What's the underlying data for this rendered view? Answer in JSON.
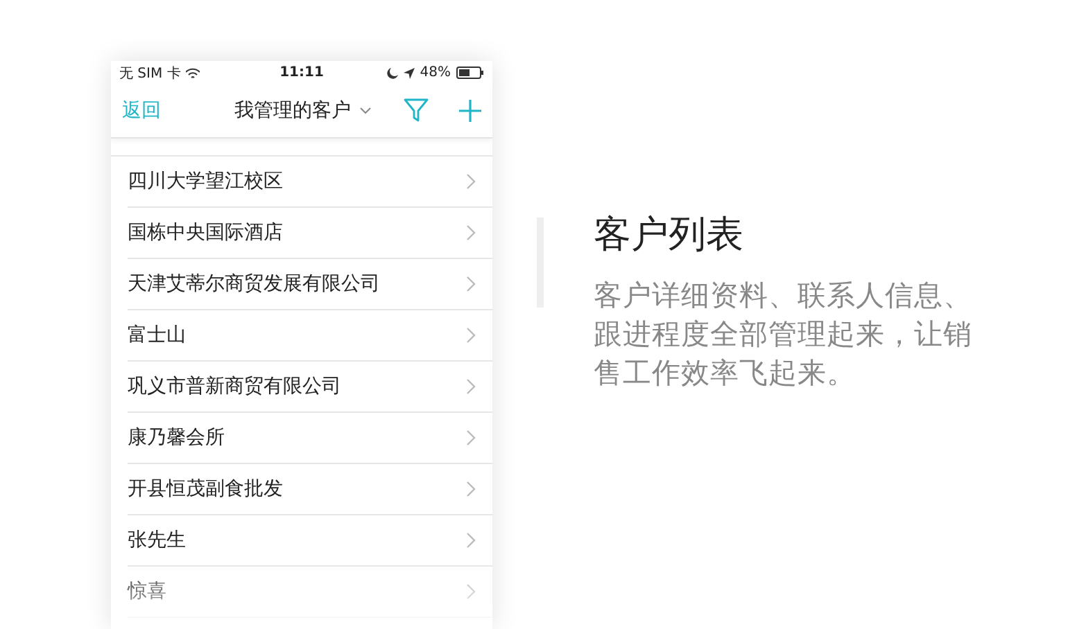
{
  "status_bar": {
    "carrier": "无 SIM 卡",
    "time": "11:11",
    "battery": "48%"
  },
  "nav": {
    "back": "返回",
    "title": "我管理的客户"
  },
  "customers": [
    {
      "name": "四川大学望江校区"
    },
    {
      "name": "国栋中央国际酒店"
    },
    {
      "name": "天津艾蒂尔商贸发展有限公司"
    },
    {
      "name": "富士山"
    },
    {
      "name": "巩义市普新商贸有限公司"
    },
    {
      "name": "康乃馨会所"
    },
    {
      "name": "开县恒茂副食批发"
    },
    {
      "name": "张先生"
    },
    {
      "name": "惊喜"
    }
  ],
  "feature": {
    "title": "客户列表",
    "description": "客户详细资料、联系人信息、跟进程度全部管理起来，让销售工作效率飞起来。"
  }
}
